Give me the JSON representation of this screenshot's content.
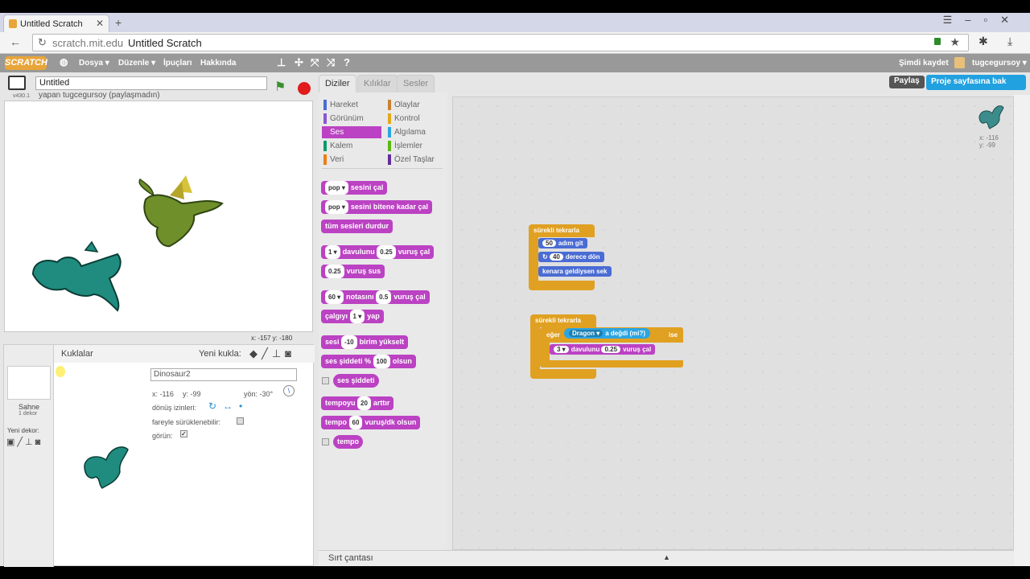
{
  "browser": {
    "tab_title": "Untitled Scratch",
    "url_host": "scratch.mit.edu",
    "url_title": "Untitled Scratch"
  },
  "menu": {
    "logo": "SCRATCH",
    "items": [
      "Dosya ▾",
      "Düzenle ▾",
      "İpuçları",
      "Hakkında"
    ],
    "save_now": "Şimdi kaydet",
    "user": "tugcegursoy ▾"
  },
  "stage": {
    "project_name": "Untitled",
    "byline": "yapan tugcegursoy (paylaşmadın)",
    "version": "v430.1",
    "coords": "x: -157  y: -180"
  },
  "sprites": {
    "title": "Kuklalar",
    "new_sprite": "Yeni kukla:",
    "stage_label": "Sahne",
    "stage_backdrops": "1 dekor",
    "new_backdrop": "Yeni dekor:",
    "sprite_name": "Dinosaur2",
    "x": "x: -116",
    "y": "y: -99",
    "dir": "yön: -30°",
    "rotation_style": "dönüş izinleri:",
    "draggable": "fareyle sürüklenebilir:",
    "show": "görün:"
  },
  "tabs": [
    "Diziler",
    "Kılıklar",
    "Sesler"
  ],
  "categories": [
    {
      "label": "Hareket",
      "color": "#4a6cd4"
    },
    {
      "label": "Olaylar",
      "color": "#c88330"
    },
    {
      "label": "Görünüm",
      "color": "#8a55d7"
    },
    {
      "label": "Kontrol",
      "color": "#e1a91a"
    },
    {
      "label": "Ses",
      "color": "#bb42c3"
    },
    {
      "label": "Algılama",
      "color": "#2ca5e2"
    },
    {
      "label": "Kalem",
      "color": "#0e9a6c"
    },
    {
      "label": "İşlemler",
      "color": "#5cb712"
    },
    {
      "label": "Veri",
      "color": "#ee7d16"
    },
    {
      "label": "Özel Taşlar",
      "color": "#632d99"
    }
  ],
  "palette_blocks": {
    "play_sound": {
      "input": "pop ▾",
      "label": "sesini çal"
    },
    "play_until": {
      "input": "pop ▾",
      "label": "sesini bitene kadar çal"
    },
    "stop_all": "tüm sesleri durdur",
    "drum": {
      "input": "1 ▾",
      "label": "davulunu",
      "beats": "0.25",
      "label2": "vuruş çal"
    },
    "rest": {
      "input": "0.25",
      "label": "vuruş sus"
    },
    "note": {
      "input": "60 ▾",
      "label": "notasını",
      "beats": "0.5",
      "label2": "vuruş çal"
    },
    "instrument": {
      "label": "çalgıyı",
      "input": "1 ▾",
      "label2": "yap"
    },
    "change_vol": {
      "label": "sesi",
      "input": "-10",
      "label2": "birim yükselt"
    },
    "set_vol": {
      "label": "ses şiddeti %",
      "input": "100",
      "label2": "olsun"
    },
    "volume": "ses şiddeti",
    "change_tempo": {
      "label": "tempoyu",
      "input": "20",
      "label2": "arttır"
    },
    "set_tempo": {
      "label": "tempo",
      "input": "60",
      "label2": "vuruş/dk olsun"
    },
    "tempo": "tempo"
  },
  "scripts": {
    "forever1": "sürekli tekrarla",
    "move": {
      "input": "50",
      "label": "adım git"
    },
    "turn": {
      "input": "40",
      "label": "derece dön"
    },
    "bounce": "kenara geldiysen sek",
    "forever2": "sürekli tekrarla",
    "if": "eğer",
    "touching": "Dragon ▾",
    "touching_label": "a değdi (mi?)",
    "then": "ise",
    "drum": {
      "input": "3 ▾",
      "label": "davulunu",
      "beats": "0.25",
      "label2": "vuruş çal"
    }
  },
  "sprite_info": {
    "x": "x: -116",
    "y": "y: -99"
  },
  "buttons": {
    "share": "Paylaş",
    "see_project": "Proje sayfasına bak"
  },
  "backpack": "Sırt çantası"
}
